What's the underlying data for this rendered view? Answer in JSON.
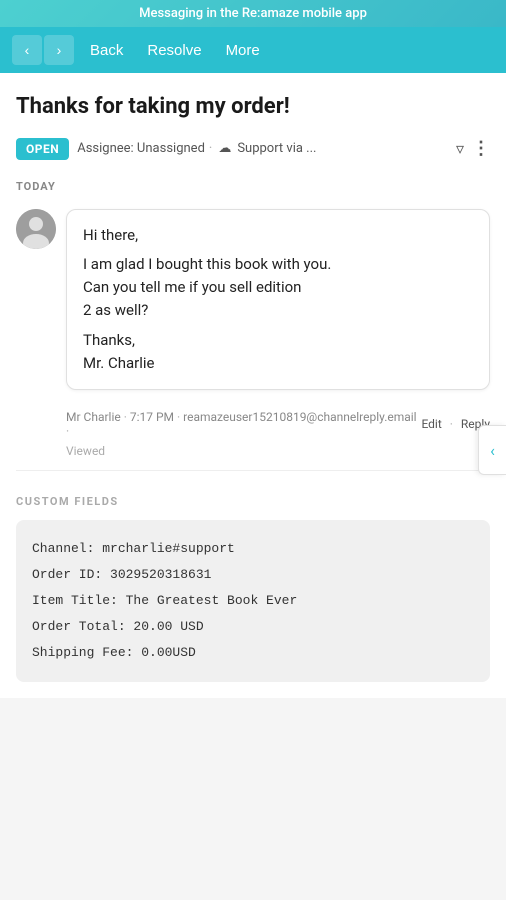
{
  "notif_bar": {
    "text": "Messaging in the Re:amaze mobile app"
  },
  "header": {
    "back_label": "Back",
    "resolve_label": "Resolve",
    "more_label": "More"
  },
  "conversation": {
    "title": "Thanks for taking my order!",
    "status": "OPEN",
    "assignee_label": "Assignee: Unassigned",
    "channel_label": "Support via ..."
  },
  "timeline": {
    "today_label": "TODAY"
  },
  "message": {
    "greeting": "Hi there,",
    "body_line1": "I am glad I bought this book with you.",
    "body_line2": "Can you tell me if you sell edition",
    "body_line3": "2 as well?",
    "closing_line1": "Thanks,",
    "closing_line2": "Mr. Charlie",
    "sender": "Mr Charlie",
    "time": "7:17 PM",
    "email": "reamazeuser15210819@channelreply.email",
    "viewed": "Viewed",
    "edit_label": "Edit",
    "reply_label": "Reply"
  },
  "custom_fields": {
    "section_title": "CUSTOM FIELDS",
    "channel": "mrcharlie#support",
    "order_id": "3029520318631",
    "item_title": "The Greatest Book Ever",
    "order_total": "20.00 USD",
    "shipping_fee": "0.00USD"
  },
  "side_tab": {
    "icon": "‹"
  }
}
